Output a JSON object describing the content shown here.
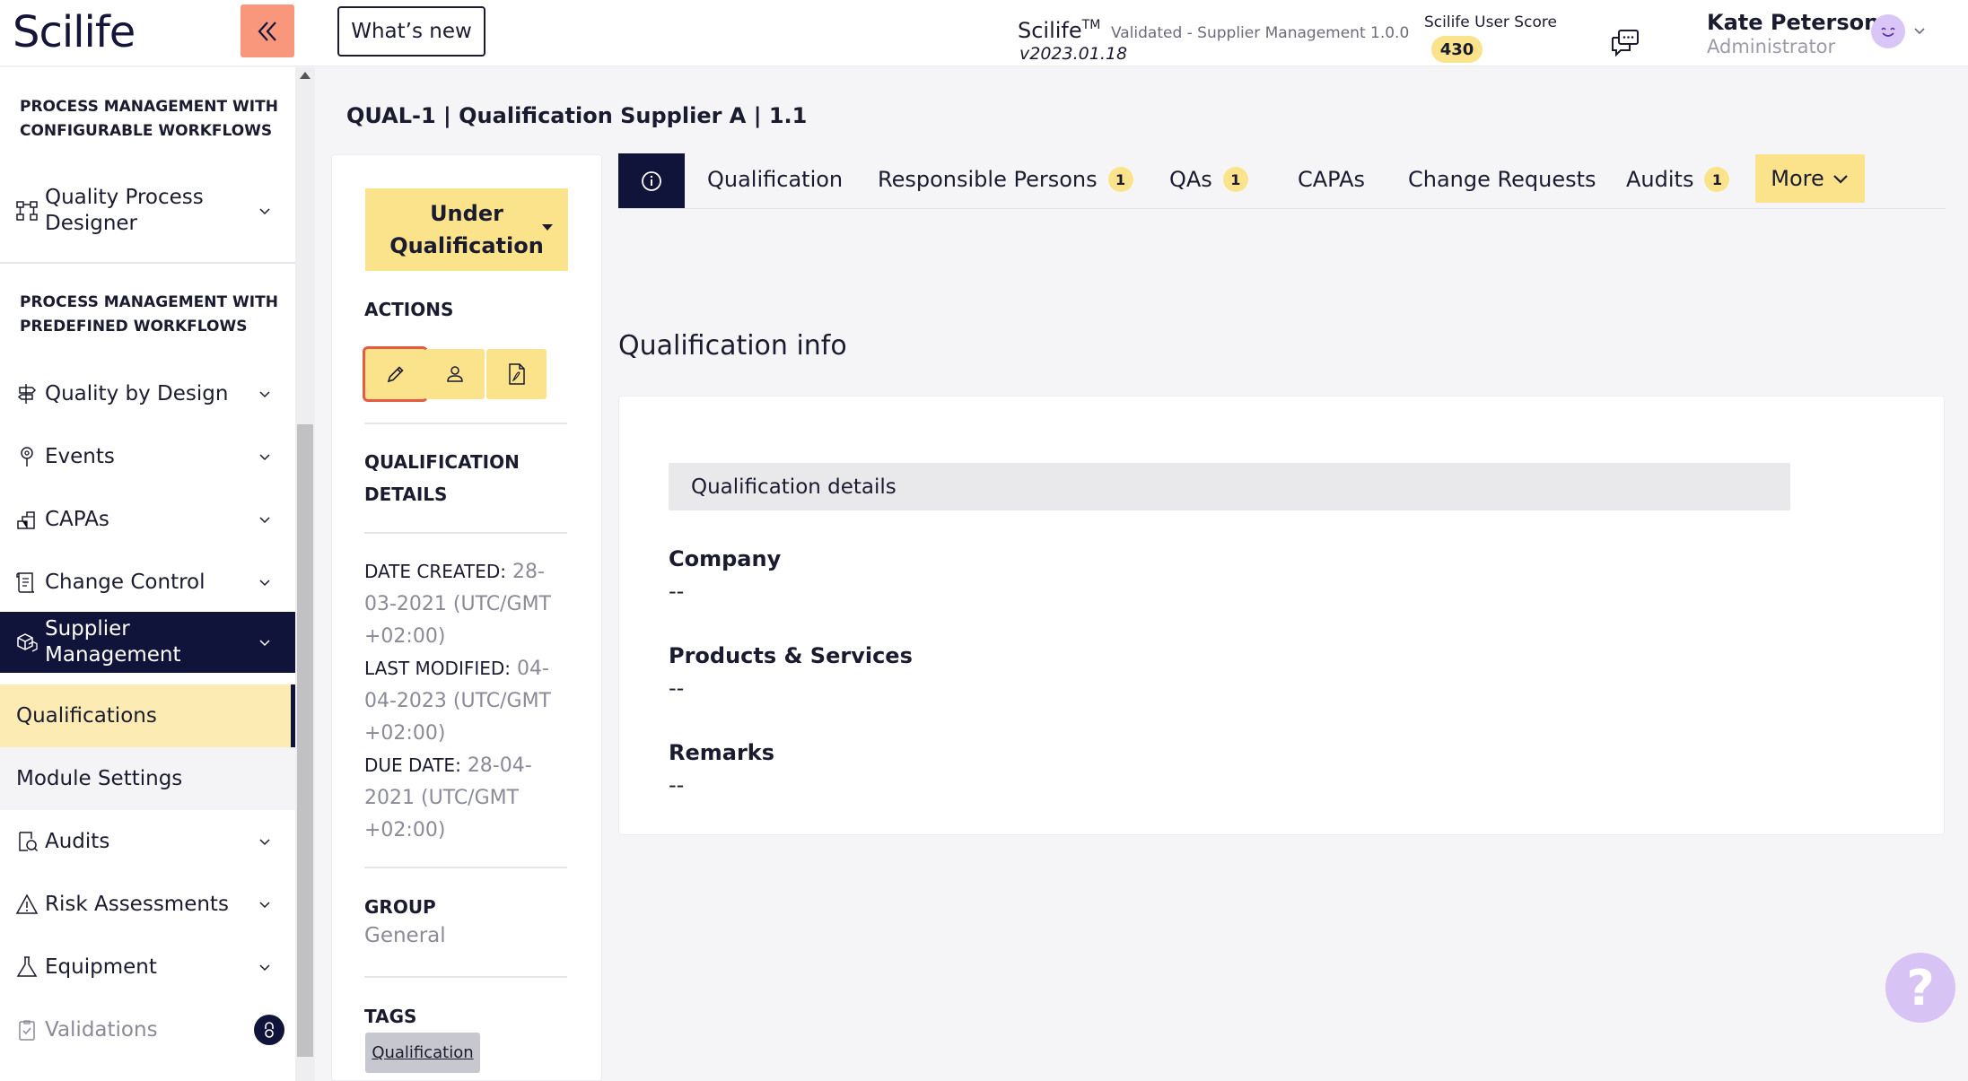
{
  "header": {
    "logo": "Scilife",
    "whats_new": "What’s new",
    "app_name": "Scilife",
    "app_tm": "TM",
    "app_validated": "Validated - Supplier Management 1.0.0",
    "app_version": "v2023.01.18",
    "score_label": "Scilife User Score",
    "score_value": "430",
    "user_name": "Kate Peterson",
    "user_role": "Administrator"
  },
  "sidebar": {
    "section1": "PROCESS MANAGEMENT WITH CONFIGURABLE WORKFLOWS",
    "quality_process_designer": "Quality Process Designer",
    "section2": "PROCESS MANAGEMENT WITH PREDEFINED WORKFLOWS",
    "items": [
      {
        "label": "Quality by Design",
        "icon": "signpost-icon"
      },
      {
        "label": "Events",
        "icon": "location-pin-icon"
      },
      {
        "label": "CAPAs",
        "icon": "puzzle-icon"
      },
      {
        "label": "Change Control",
        "icon": "scroll-icon"
      },
      {
        "label": "Supplier Management",
        "icon": "boxes-icon"
      },
      {
        "label": "Audits",
        "icon": "audit-search-icon"
      },
      {
        "label": "Risk Assessments",
        "icon": "warning-triangle-icon"
      },
      {
        "label": "Equipment",
        "icon": "flask-icon"
      },
      {
        "label": "Validations",
        "icon": "clipboard-check-icon"
      }
    ],
    "sub_items": [
      "Qualifications",
      "Module Settings"
    ]
  },
  "record": {
    "title": "QUAL-1 | Qualification Supplier A | 1.1",
    "status": "Under Qualification",
    "actions_heading": "ACTIONS",
    "details_heading": "QUALIFICATION DETAILS",
    "date_created_label": "DATE CREATED:",
    "date_created_value": "28-03-2021 (UTC/GMT +02:00)",
    "last_modified_label": "LAST MODIFIED:",
    "last_modified_value": "04-04-2023 (UTC/GMT +02:00)",
    "due_date_label": "DUE DATE:",
    "due_date_value": "28-04-2021 (UTC/GMT +02:00)",
    "group_heading": "GROUP",
    "group_value": "General",
    "tags_heading": "TAGS",
    "tag": "Qualification"
  },
  "tabs": [
    {
      "label": "Qualification",
      "count": ""
    },
    {
      "label": "Responsible Persons",
      "count": "1"
    },
    {
      "label": "QAs",
      "count": "1"
    },
    {
      "label": "CAPAs",
      "count": ""
    },
    {
      "label": "Change Requests",
      "count": ""
    },
    {
      "label": "Audits",
      "count": "1"
    }
  ],
  "more_label": "More",
  "main": {
    "heading": "Qualification info",
    "subheader": "Qualification details",
    "fields": [
      {
        "label": "Company",
        "value": "--"
      },
      {
        "label": "Products & Services",
        "value": "--"
      },
      {
        "label": "Remarks",
        "value": "--"
      }
    ]
  },
  "help": "?",
  "colors": {
    "navy": "#11143a",
    "accent_yellow": "#fbe38c",
    "collapse_orange": "#f8977c",
    "highlight_red": "#e55b44",
    "help_purple": "#d8c3f5"
  }
}
